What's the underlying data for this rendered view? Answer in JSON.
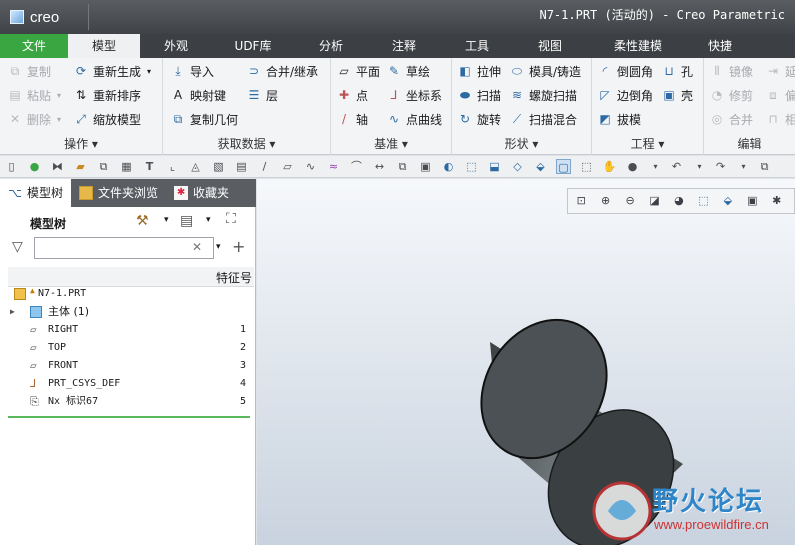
{
  "app": {
    "logo": "creo",
    "title": "N7-1.PRT (活动的) - Creo Parametric"
  },
  "tabs": [
    "文件",
    "模型",
    "外观",
    "UDF库",
    "分析",
    "注释",
    "工具",
    "视图",
    "柔性建模",
    "快捷"
  ],
  "active_tab": "模型",
  "ribbon": {
    "ops": {
      "title": "操作 ▾",
      "copy": "复制",
      "paste": "粘贴",
      "delete": "删除",
      "regen": "重新生成",
      "reorder": "重新排序",
      "scale": "缩放模型"
    },
    "getdata": {
      "title": "获取数据 ▾",
      "import": "导入",
      "merge": "合并/继承",
      "shrink": "映射键",
      "layer": "层",
      "copygeom": "复制几何"
    },
    "datum": {
      "title": "基准 ▾",
      "plane": "平面",
      "sketch": "草绘",
      "point": "点",
      "csys": "坐标系",
      "axis": "轴",
      "curve": "点曲线"
    },
    "shape": {
      "title": "形状 ▾",
      "extrude": "拉伸",
      "mold": "模具/铸造",
      "sweep": "扫描",
      "helical": "螺旋扫描",
      "revolve": "旋转",
      "blend": "扫描混合"
    },
    "eng": {
      "title": "工程 ▾",
      "round": "倒圆角",
      "hole": "孔",
      "chamfer": "边倒角",
      "shell": "壳",
      "draft": "拔模"
    },
    "edit": {
      "title": "编辑",
      "mirror": "镜像",
      "modify": "修剪",
      "merge": "合并",
      "extend": "延",
      "offset": "偏",
      "inter": "相"
    }
  },
  "panel_tabs": [
    "模型树",
    "文件夹浏览",
    "收藏夹"
  ],
  "model_tree": {
    "title": "模型树",
    "column": "特征号",
    "filter_placeholder": "",
    "items": [
      {
        "name": "N7-1.PRT",
        "num": ""
      },
      {
        "name": "主体 (1)",
        "num": ""
      },
      {
        "name": "RIGHT",
        "num": "1"
      },
      {
        "name": "TOP",
        "num": "2"
      },
      {
        "name": "FRONT",
        "num": "3"
      },
      {
        "name": "PRT_CSYS_DEF",
        "num": "4"
      },
      {
        "name": "Nx 标识67",
        "num": "5"
      }
    ]
  },
  "watermark": {
    "title": "野火论坛",
    "url": "www.proewildfire.cn"
  },
  "colors": {
    "accent": "#3aa642",
    "titlebar": "#3f4246",
    "tabbar": "#3c3f43"
  }
}
